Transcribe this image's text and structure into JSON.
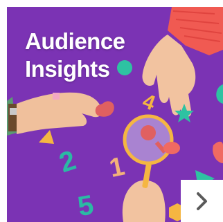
{
  "card": {
    "title_line1": "Audience",
    "title_line2": "Insights",
    "background_color": "#7b33b4",
    "title_color": "#ffffff"
  },
  "next_button": {
    "icon": "chevron-right-icon",
    "icon_color": "#5a5a5a",
    "background_color": "#ffffff"
  }
}
